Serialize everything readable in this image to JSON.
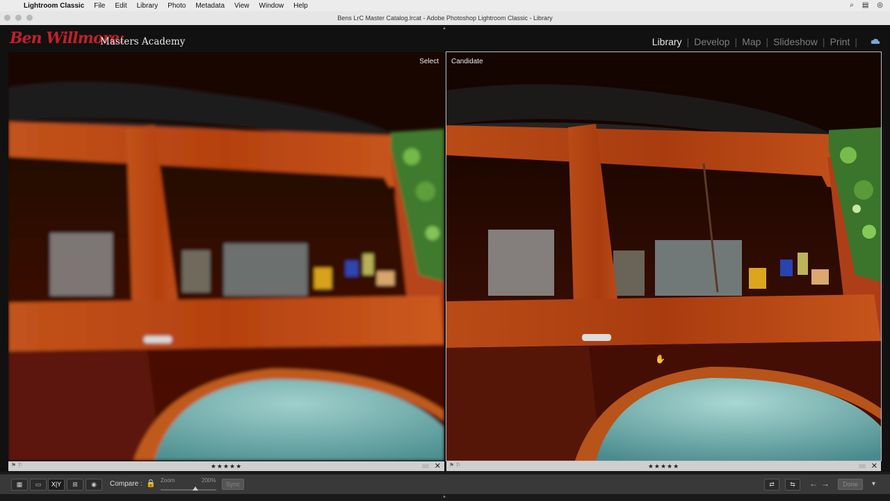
{
  "menubar": {
    "app_name": "Lightroom Classic",
    "items": [
      "File",
      "Edit",
      "Library",
      "Photo",
      "Metadata",
      "View",
      "Window",
      "Help"
    ]
  },
  "window": {
    "title": "Bens LrC Master Catalog.lrcat - Adobe Photoshop Lightroom Classic - Library"
  },
  "identity": {
    "script": "Ben Willmore:",
    "text": "Masters Academy",
    "script_color": "#c2202a"
  },
  "modules": {
    "items": [
      "Library",
      "Develop",
      "Map",
      "Slideshow",
      "Print"
    ],
    "active": "Library"
  },
  "compare": {
    "select_label": "Select",
    "candidate_label": "Candidate",
    "select_stars": "★★★★★",
    "candidate_stars": "★★★★★"
  },
  "toolbar": {
    "compare_label": "Compare :",
    "zoom_label": "Zoom",
    "zoom_value": "200%",
    "sync_label": "Sync",
    "done_label": "Done",
    "view_xy_label": "X|Y"
  },
  "icons": {
    "grid": "grid-view-icon",
    "loupe": "loupe-view-icon",
    "compare": "compare-view-icon",
    "survey": "survey-view-icon",
    "people": "people-view-icon",
    "lock": "lock-icon"
  }
}
